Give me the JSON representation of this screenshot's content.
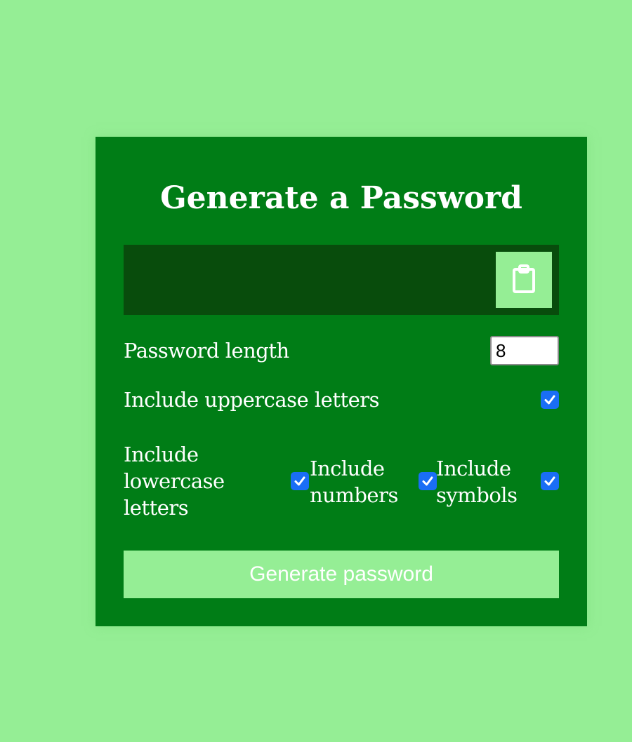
{
  "title": "Generate a Password",
  "result": {
    "value": "",
    "copy_icon": "clipboard-icon"
  },
  "length": {
    "label": "Password length",
    "value": "8"
  },
  "options": {
    "uppercase": {
      "label": "Include uppercase letters",
      "checked": true
    },
    "lowercase": {
      "label_line1": "Include",
      "label_line2": "lowercase",
      "label_line3": "letters",
      "checked": true
    },
    "numbers": {
      "label_line1": "Include",
      "label_line2": "numbers",
      "checked": true
    },
    "symbols": {
      "label_line1": "Include",
      "label_line2": "symbols",
      "checked": true
    }
  },
  "generate_button": {
    "label": "Generate password"
  },
  "colors": {
    "background": "#95ee95",
    "card": "#007d16",
    "result_box": "#084c0c",
    "checkbox": "#1a6ef5",
    "text": "#ffffff"
  }
}
